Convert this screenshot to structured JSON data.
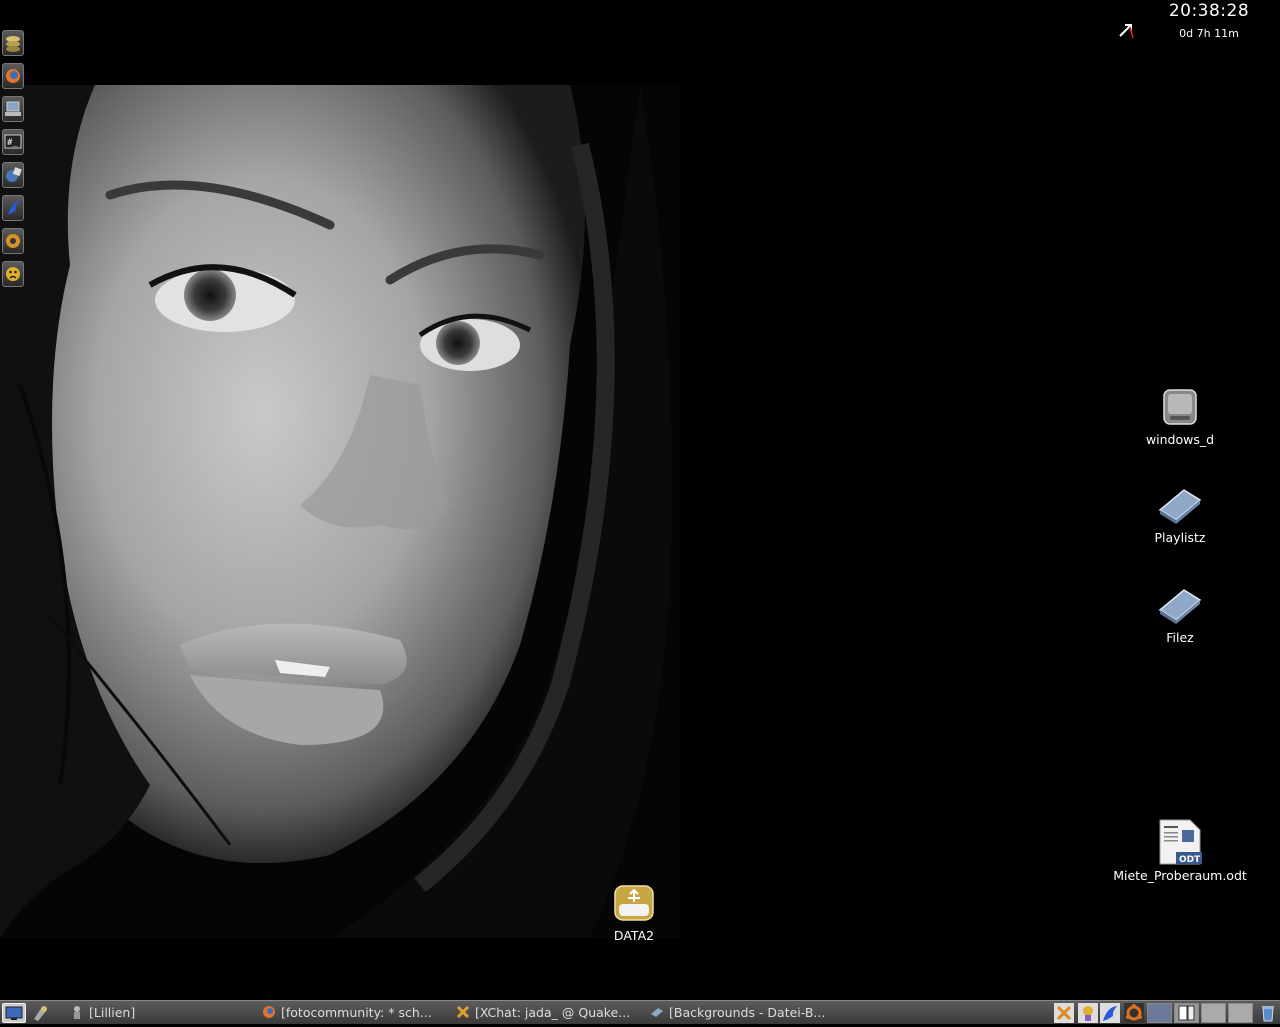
{
  "clock": {
    "time": "20:38:28",
    "uptime": "0d 7h 11m"
  },
  "launcher": [
    {
      "name": "coins-app-icon"
    },
    {
      "name": "firefox-icon"
    },
    {
      "name": "laptop-icon"
    },
    {
      "name": "terminal-icon"
    },
    {
      "name": "network-globe-icon"
    },
    {
      "name": "blue-bird-icon"
    },
    {
      "name": "media-player-icon"
    },
    {
      "name": "warning-face-icon"
    }
  ],
  "desktop_icons": {
    "windows_d": "windows_d",
    "playlistz": "Playlistz",
    "filez": "Filez",
    "miete": "Miete_Proberaum.odt",
    "data2": "DATA2"
  },
  "taskbar": {
    "tasks": [
      {
        "label": "[Lillien]"
      },
      {
        "label": "[fotocommunity: * sch..."
      },
      {
        "label": "[XChat: jada_ @ Quake..."
      },
      {
        "label": "[Backgrounds - Datei-B..."
      }
    ]
  },
  "colors": {
    "taskbar": "#4a4a4a",
    "desktop": "#000000"
  }
}
